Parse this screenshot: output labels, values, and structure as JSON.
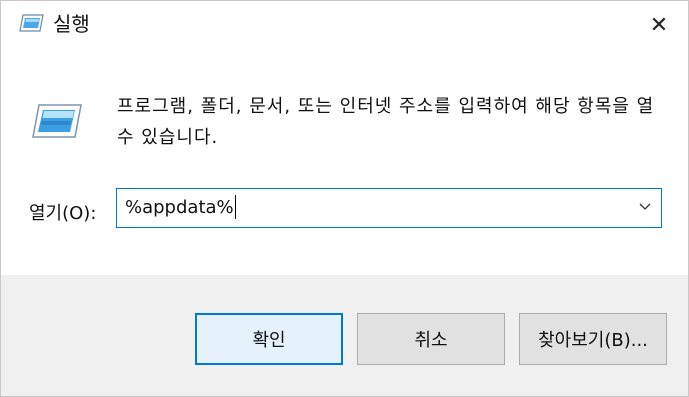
{
  "window": {
    "title": "실행",
    "close_symbol": "✕"
  },
  "dialog": {
    "description": "프로그램, 폴더, 문서, 또는 인터넷 주소를 입력하여 해당 항목을 열 수 있습니다.",
    "open_label": "열기(O):",
    "open_value": "%appdata%"
  },
  "buttons": {
    "ok": "확인",
    "cancel": "취소",
    "browse": "찾아보기(B)..."
  },
  "icons": {
    "title": "run-icon",
    "content": "run-icon-large",
    "close": "close-icon",
    "dropdown": "chevron-down-icon"
  },
  "colors": {
    "accent": "#0078d7",
    "footer": "#f0f0f0"
  }
}
